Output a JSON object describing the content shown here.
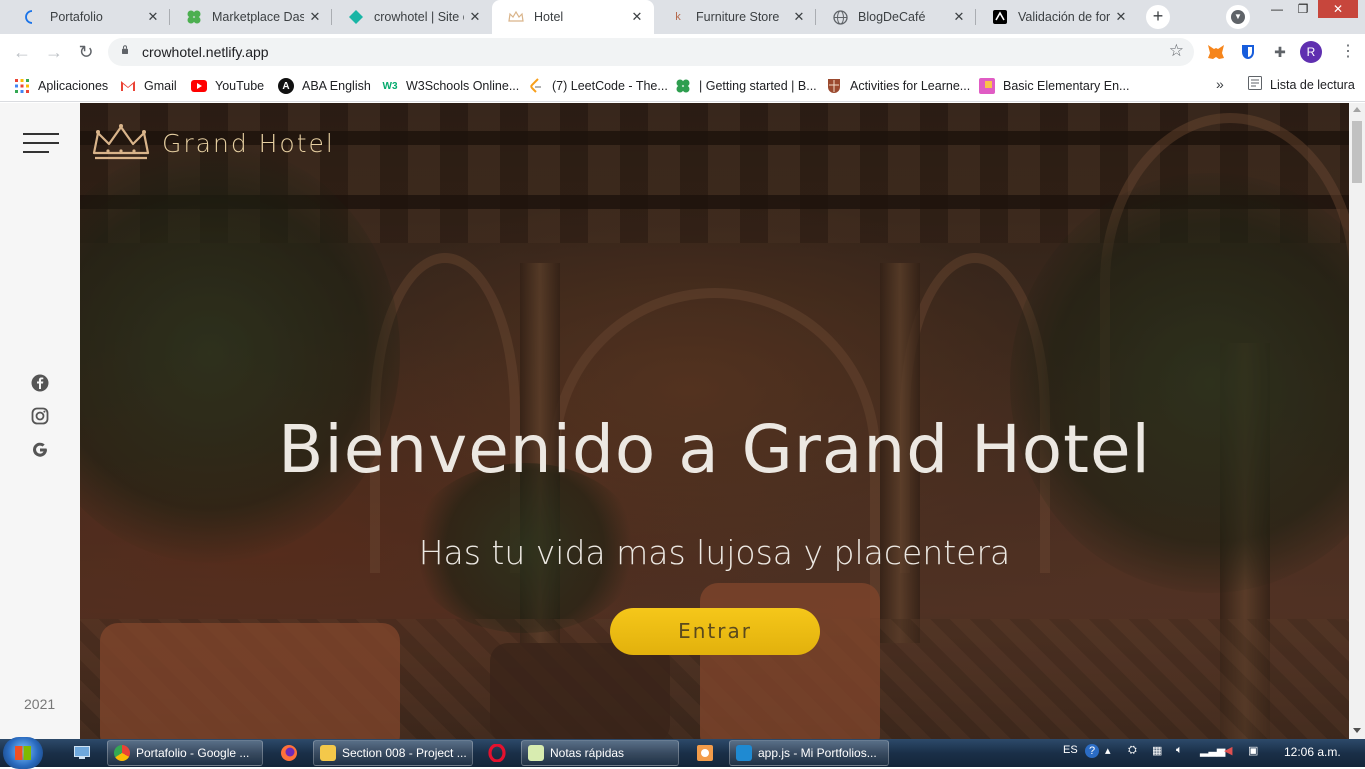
{
  "browser": {
    "tabs": [
      {
        "title": "Portafolio",
        "icon": "loading-spinner-icon",
        "color": "#1a73e8",
        "active": false
      },
      {
        "title": "Marketplace Dashb",
        "icon": "clover-icon",
        "color": "#4caf50",
        "active": false
      },
      {
        "title": "crowhotel | Site ov",
        "icon": "netlify-icon",
        "color": "#19b5a5",
        "active": false
      },
      {
        "title": "Hotel",
        "icon": "crown-icon",
        "color": "#d9b48a",
        "active": true
      },
      {
        "title": "Furniture Store",
        "icon": "furniture-icon",
        "color": "#b4684b",
        "active": false
      },
      {
        "title": "BlogDeCafé",
        "icon": "globe-icon",
        "color": "#5f6368",
        "active": false
      },
      {
        "title": "Validación de form",
        "icon": "form-icon",
        "color": "#000000",
        "active": false
      }
    ],
    "url": "crowhotel.netlify.app",
    "avatar_initial": "R",
    "bookmarks": [
      {
        "label": "Aplicaciones",
        "icon": "apps-grid-icon"
      },
      {
        "label": "Gmail",
        "icon": "gmail-icon"
      },
      {
        "label": "YouTube",
        "icon": "youtube-icon"
      },
      {
        "label": "ABA English",
        "icon": "aba-icon",
        "glyph": "A"
      },
      {
        "label": "W3Schools Online...",
        "icon": "w3schools-icon",
        "glyph": "W3"
      },
      {
        "label": "(7) LeetCode - The...",
        "icon": "leetcode-icon"
      },
      {
        "label": "| Getting started | B...",
        "icon": "clover-icon"
      },
      {
        "label": "Activities for Learne...",
        "icon": "cambridge-icon"
      },
      {
        "label": "Basic Elementary En...",
        "icon": "puzzle-bookmark-icon"
      }
    ],
    "more_bookmarks": "»",
    "reading_list": "Lista de lectura"
  },
  "site": {
    "brand": "Grand Hotel",
    "headline": "Bienvenido a Grand Hotel",
    "subheadline": "Has tu vida mas lujosa y placentera",
    "cta": "Entrar",
    "year": "2021",
    "social": [
      {
        "name": "facebook-icon"
      },
      {
        "name": "instagram-icon"
      },
      {
        "name": "google-icon"
      }
    ],
    "accent": "#f2c416",
    "brand_color": "#e6cfa1"
  },
  "taskbar": {
    "tasks": [
      {
        "label": "Portafolio - Google ...",
        "icon": "chrome-icon"
      },
      {
        "label": "Section 008 - Project ...",
        "icon": "folder-icon"
      },
      {
        "label": "Notas rápidas",
        "icon": "sticky-notes-icon"
      },
      {
        "label": "app.js - Mi Portfolios...",
        "icon": "vscode-icon"
      }
    ],
    "language": "ES",
    "clock": "12:06 a.m."
  }
}
